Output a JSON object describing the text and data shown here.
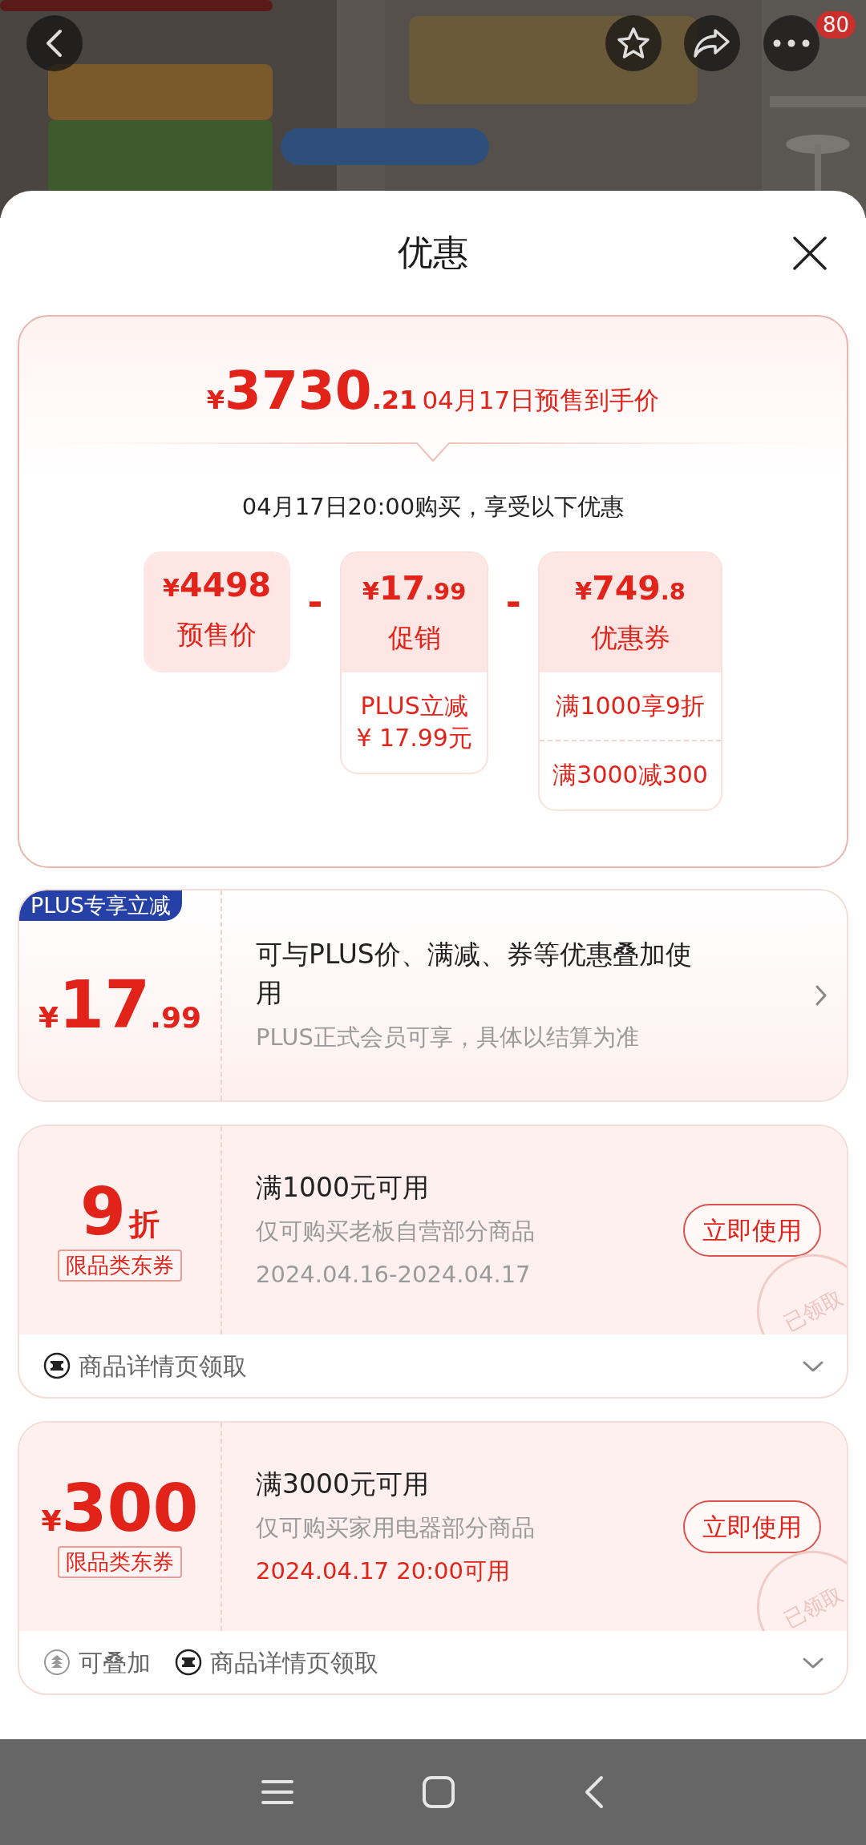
{
  "header": {
    "badge": "80"
  },
  "sheet": {
    "title": "优惠"
  },
  "summary": {
    "currency": "¥",
    "price_int": "3730",
    "price_dec": ".21",
    "label": "04月17日预售到手价",
    "subtitle": "04月17日20:00购买，享受以下优惠",
    "breakdown": [
      {
        "currency": "¥",
        "amount": "4498",
        "label": "预售价"
      },
      {
        "operator": "-",
        "currency": "¥",
        "amount": "17",
        "decimal": ".99",
        "label": "促销",
        "details": [
          {
            "lines": [
              "PLUS立减",
              "¥ 17.99元"
            ]
          }
        ]
      },
      {
        "operator": "-",
        "currency": "¥",
        "amount": "749",
        "decimal": ".8",
        "label": "优惠券",
        "details": [
          {
            "lines": [
              "满1000享9折"
            ]
          },
          {
            "lines": [
              "满3000减300"
            ]
          }
        ]
      }
    ]
  },
  "offers": [
    {
      "kind": "plus",
      "tag": "PLUS专享立减",
      "currency": "¥",
      "amount": "17",
      "decimal": ".99",
      "title": "可与PLUS价、满减、券等优惠叠加使用",
      "note": "PLUS正式会员可享，具体以结算为准"
    },
    {
      "kind": "coupon",
      "amount": "9",
      "unit": "折",
      "type": "限品类东券",
      "title": "满1000元可用",
      "description": "仅可购买老板自营部分商品",
      "validity": "2024.04.16-2024.04.17",
      "validity_highlight": false,
      "button": "立即使用",
      "stamp": "已领取",
      "expanded": false,
      "tags": [
        {
          "kind": "source",
          "text": "商品详情页领取"
        }
      ]
    },
    {
      "kind": "coupon",
      "currency": "¥",
      "amount": "300",
      "type": "限品类东券",
      "title": "满3000元可用",
      "description": "仅可购买家用电器部分商品",
      "validity": "2024.04.17 20:00可用",
      "validity_highlight": true,
      "button": "立即使用",
      "stamp": "已领取",
      "expanded": false,
      "tags": [
        {
          "kind": "stackable",
          "text": "可叠加"
        },
        {
          "kind": "source",
          "text": "商品详情页领取"
        }
      ]
    }
  ]
}
